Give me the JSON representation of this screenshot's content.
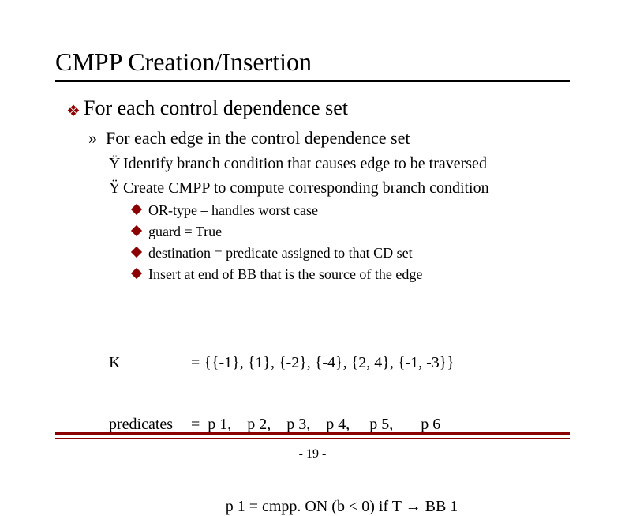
{
  "title": "CMPP Creation/Insertion",
  "bullets": {
    "l1_diamond": "❖",
    "l1": "For each control dependence set",
    "l2_marker": "»",
    "l2": "For each edge in the control dependence set",
    "l3_marker": "Ÿ",
    "l3a": "Identify branch condition that causes edge to be traversed",
    "l3b": "Create CMPP to compute corresponding branch condition",
    "l4_marker": "◆",
    "l4a": "OR-type – handles worst case",
    "l4b": "guard = True",
    "l4c": "destination = predicate assigned to that CD set",
    "l4d": "Insert at end of BB that is the source of the edge"
  },
  "k": {
    "label_k": "K",
    "eq": "=",
    "sets": "{{-1}, {1}, {-2}, {-4}, {2, 4}, {-1, -3}}",
    "label_pred": "predicates",
    "preds": "  p 1,    p 2,    p 3,    p 4,     p 5,       p 6"
  },
  "formula": {
    "lhs": "p 1 = cmpp. ON (b < 0) if T ",
    "arrow": "→",
    "rhs": " BB 1"
  },
  "pagenum": "- 19 -"
}
